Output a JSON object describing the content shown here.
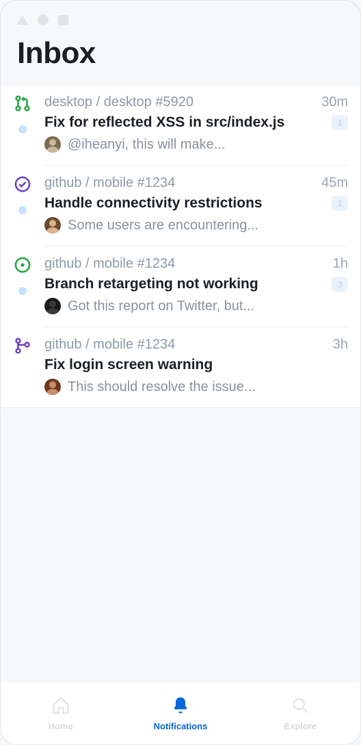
{
  "header": {
    "title": "Inbox"
  },
  "items": [
    {
      "type": "pull-request",
      "icon_color": "#28a745",
      "repo": "desktop / desktop #5920",
      "time": "30m",
      "title": "Fix for reflected XSS in src/index.js",
      "badge": "1",
      "unread": true,
      "snippet": "@iheanyi, this will make...",
      "avatar_colors": [
        "#c9b89a",
        "#7a6a4f"
      ]
    },
    {
      "type": "issue-closed",
      "icon_color": "#6f42c1",
      "repo": "github / mobile #1234",
      "time": "45m",
      "title": "Handle connectivity restrictions",
      "badge": "1",
      "unread": true,
      "snippet": "Some users are encountering...",
      "avatar_colors": [
        "#d9b38c",
        "#6b4a2e"
      ]
    },
    {
      "type": "issue-open",
      "icon_color": "#28a745",
      "repo": "github / mobile #1234",
      "time": "1h",
      "title": "Branch retargeting not working",
      "badge": "3",
      "unread": true,
      "snippet": "Got this report on Twitter, but...",
      "avatar_colors": [
        "#3a3a3a",
        "#1a1a1a"
      ]
    },
    {
      "type": "merged",
      "icon_color": "#6f42c1",
      "repo": "github / mobile #1234",
      "time": "3h",
      "title": "Fix login screen warning",
      "badge": "",
      "unread": false,
      "snippet": "This should resolve the issue...",
      "avatar_colors": [
        "#c98f6b",
        "#6b3a1e"
      ]
    }
  ],
  "tabbar": {
    "home": "Home",
    "notifications": "Notifications",
    "explore": "Explore"
  }
}
